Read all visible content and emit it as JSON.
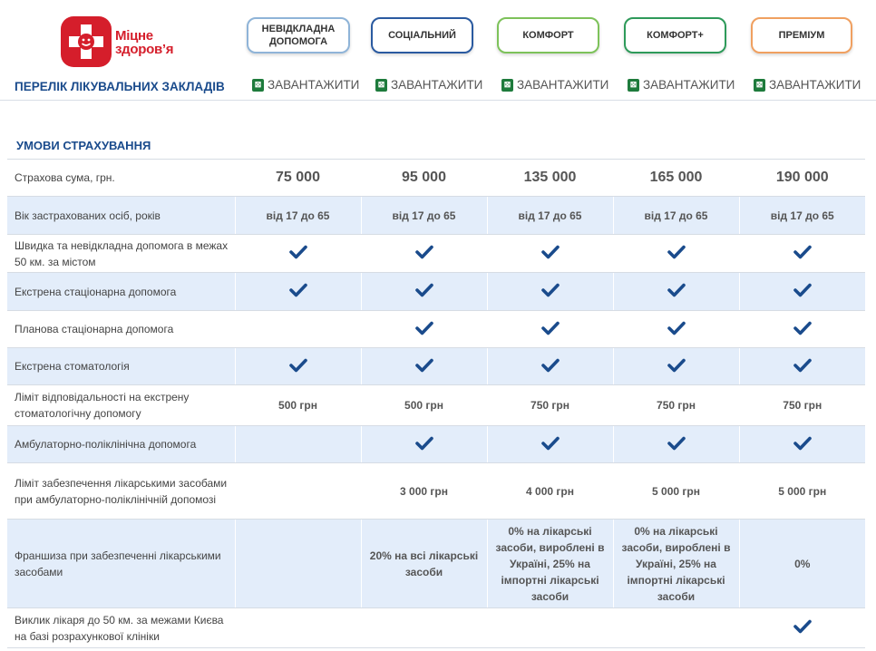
{
  "brand": {
    "line1": "Міцне",
    "line2": "здоров’я"
  },
  "plans": [
    {
      "label": "НЕВІДКЛАДНА ДОПОМОГА",
      "color": "#8fb4d8",
      "download": "ЗАВАНТАЖИТИ"
    },
    {
      "label": "СОЦІАЛЬНИЙ",
      "color": "#2a5aa0",
      "download": "ЗАВАНТАЖИТИ"
    },
    {
      "label": "КОМФОРТ",
      "color": "#7dc25a",
      "download": "ЗАВАНТАЖИТИ"
    },
    {
      "label": "КОМФОРТ+",
      "color": "#2e9a5a",
      "download": "ЗАВАНТАЖИТИ"
    },
    {
      "label": "ПРЕМІУМ",
      "color": "#f0a060",
      "download": "ЗАВАНТАЖИТИ"
    }
  ],
  "list_title": "ПЕРЕЛІК ЛІКУВАЛЬНИХ ЗАКЛАДІВ",
  "xls_icon": "excel-icon",
  "section_title": "УМОВИ СТРАХУВАННЯ",
  "rows": [
    {
      "label": "Страхова сума, грн.",
      "style": "big",
      "cells": [
        "75 000",
        "95 000",
        "135 000",
        "165 000",
        "190 000"
      ]
    },
    {
      "label": "Вік застрахованих осіб, років",
      "style": "val",
      "cells": [
        "від 17 до 65",
        "від 17 до 65",
        "від 17 до 65",
        "від 17 до 65",
        "від 17 до 65"
      ]
    },
    {
      "label": "Швидка та невідкладна допомога в межах 50 км. за містом",
      "cells": [
        "check",
        "check",
        "check",
        "check",
        "check"
      ]
    },
    {
      "label": "Екстрена стаціонарна допомога",
      "cells": [
        "check",
        "check",
        "check",
        "check",
        "check"
      ]
    },
    {
      "label": "Планова стаціонарна допомога",
      "cells": [
        "",
        "check",
        "check",
        "check",
        "check"
      ]
    },
    {
      "label": "Екстрена стоматологія",
      "cells": [
        "check",
        "check",
        "check",
        "check",
        "check"
      ]
    },
    {
      "label": "Ліміт відповідальності на екстрену стоматологічну допомогу",
      "style": "val",
      "cells": [
        "500 грн",
        "500 грн",
        "750 грн",
        "750 грн",
        "750 грн"
      ]
    },
    {
      "label": "Амбулаторно-поліклінічна допомога",
      "cells": [
        "",
        "check",
        "check",
        "check",
        "check"
      ]
    },
    {
      "label": "Ліміт забезпечення лікарськими засобами при амбулаторно-поліклінічній допомозі",
      "style": "val",
      "cells": [
        "",
        "3 000 грн",
        "4 000 грн",
        "5 000 грн",
        "5 000 грн"
      ]
    },
    {
      "label": "Франшиза при забезпеченні лікарськими засобами",
      "style": "val",
      "cells": [
        "",
        "20% на всі лікарські засоби",
        "0% на лікарські засоби, вироблені в Україні, 25% на імпортні лікарські засоби",
        "0% на лікарські засоби, вироблені в Україні, 25% на імпортні лікарські засоби",
        "0%"
      ]
    },
    {
      "label": "Виклик лікаря до 50 км. за межами Києва на базі розрахункової клініки",
      "cells": [
        "",
        "",
        "",
        "",
        "check"
      ]
    }
  ],
  "colors": {
    "heading": "#1a4b8c",
    "row_alt": "#e3edfa",
    "check": "#1a4b8c",
    "brand_red": "#d51e2b"
  }
}
